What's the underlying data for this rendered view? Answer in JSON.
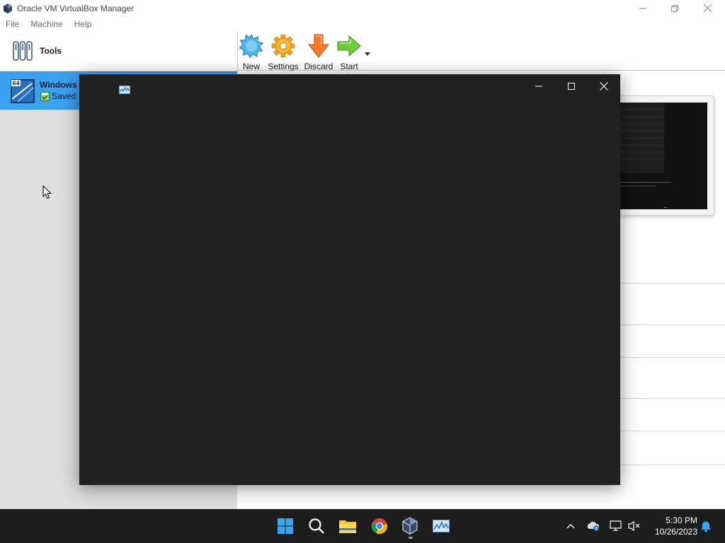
{
  "window": {
    "title": "Oracle VM VirtualBox Manager",
    "controls": {
      "minimize": "minimize",
      "restore": "restore",
      "close": "close"
    }
  },
  "menu": {
    "items": [
      {
        "label": "File"
      },
      {
        "label": "Machine"
      },
      {
        "label": "Help"
      }
    ]
  },
  "sidebar": {
    "tools_label": "Tools",
    "vm": {
      "name": "Windows I",
      "arch_badge": "64",
      "state": "Saved"
    }
  },
  "toolbar": {
    "buttons": [
      {
        "label": "New",
        "icon": "new-star-icon"
      },
      {
        "label": "Settings",
        "icon": "gear-icon"
      },
      {
        "label": "Discard",
        "icon": "discard-arrow-down-icon"
      },
      {
        "label": "Start",
        "icon": "start-arrow-right-icon"
      }
    ]
  },
  "overlay_window": {
    "icon": "performance-graph-icon",
    "background": "#202020"
  },
  "taskbar": {
    "apps": [
      {
        "name": "start-menu",
        "icon": "windows-logo-icon"
      },
      {
        "name": "search",
        "icon": "search-icon"
      },
      {
        "name": "file-explorer",
        "icon": "folder-icon"
      },
      {
        "name": "chrome",
        "icon": "chrome-icon"
      },
      {
        "name": "virtualbox",
        "icon": "virtualbox-icon"
      },
      {
        "name": "performance-monitor",
        "icon": "performance-graph-icon"
      }
    ],
    "time": "5:30 PM",
    "date": "10/26/2023"
  },
  "colors": {
    "selection": "#3aa0f0",
    "taskbar": "#1c1c1c",
    "sidebar": "#dedede"
  }
}
